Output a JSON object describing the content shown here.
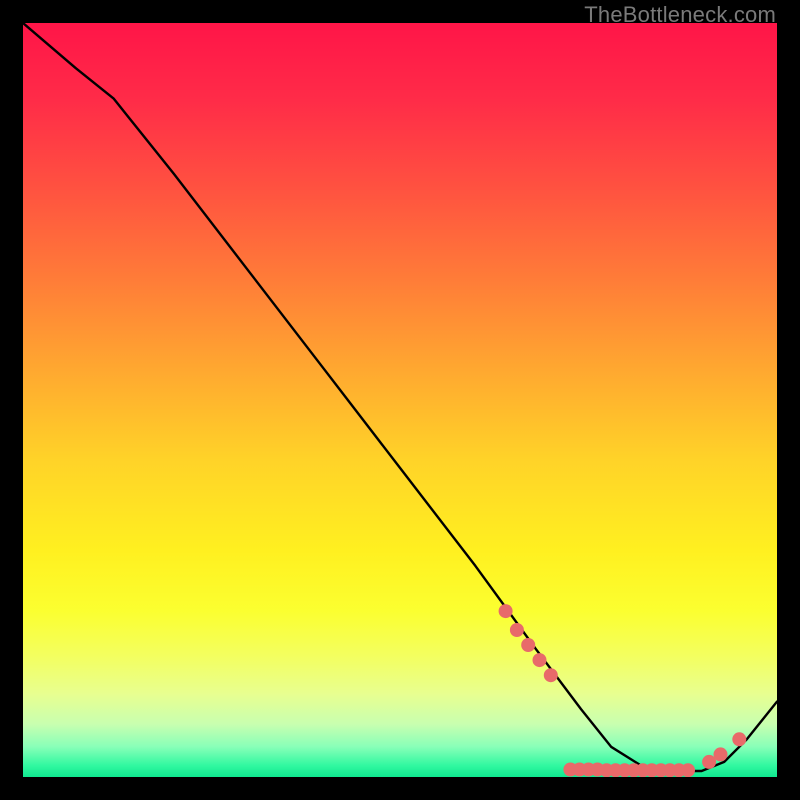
{
  "watermark": "TheBottleneck.com",
  "chart_data": {
    "type": "line",
    "title": "",
    "xlabel": "",
    "ylabel": "",
    "xlim": [
      0,
      100
    ],
    "ylim": [
      0,
      100
    ],
    "series": [
      {
        "name": "bottleneck-curve",
        "x": [
          0,
          7,
          12,
          20,
          30,
          40,
          50,
          60,
          68,
          74,
          78,
          82,
          86,
          90,
          93,
          96,
          100
        ],
        "y": [
          100,
          94,
          90,
          80,
          67,
          54,
          41,
          28,
          17,
          9,
          4,
          1.5,
          0.8,
          0.8,
          2.0,
          5.0,
          10
        ]
      }
    ],
    "markers": {
      "name": "highlight-dots",
      "color": "#e86a6a",
      "points": [
        {
          "x": 64.0,
          "y": 22.0
        },
        {
          "x": 65.5,
          "y": 19.5
        },
        {
          "x": 67.0,
          "y": 17.5
        },
        {
          "x": 68.5,
          "y": 15.5
        },
        {
          "x": 70.0,
          "y": 13.5
        },
        {
          "x": 72.6,
          "y": 1.0
        },
        {
          "x": 73.8,
          "y": 1.0
        },
        {
          "x": 75.0,
          "y": 1.0
        },
        {
          "x": 76.2,
          "y": 1.0
        },
        {
          "x": 77.4,
          "y": 0.9
        },
        {
          "x": 78.6,
          "y": 0.9
        },
        {
          "x": 79.8,
          "y": 0.9
        },
        {
          "x": 81.0,
          "y": 0.9
        },
        {
          "x": 82.2,
          "y": 0.9
        },
        {
          "x": 83.4,
          "y": 0.9
        },
        {
          "x": 84.6,
          "y": 0.9
        },
        {
          "x": 85.8,
          "y": 0.9
        },
        {
          "x": 87.0,
          "y": 0.9
        },
        {
          "x": 88.2,
          "y": 0.9
        },
        {
          "x": 91.0,
          "y": 2.0
        },
        {
          "x": 92.5,
          "y": 3.0
        },
        {
          "x": 95.0,
          "y": 5.0
        }
      ]
    }
  }
}
